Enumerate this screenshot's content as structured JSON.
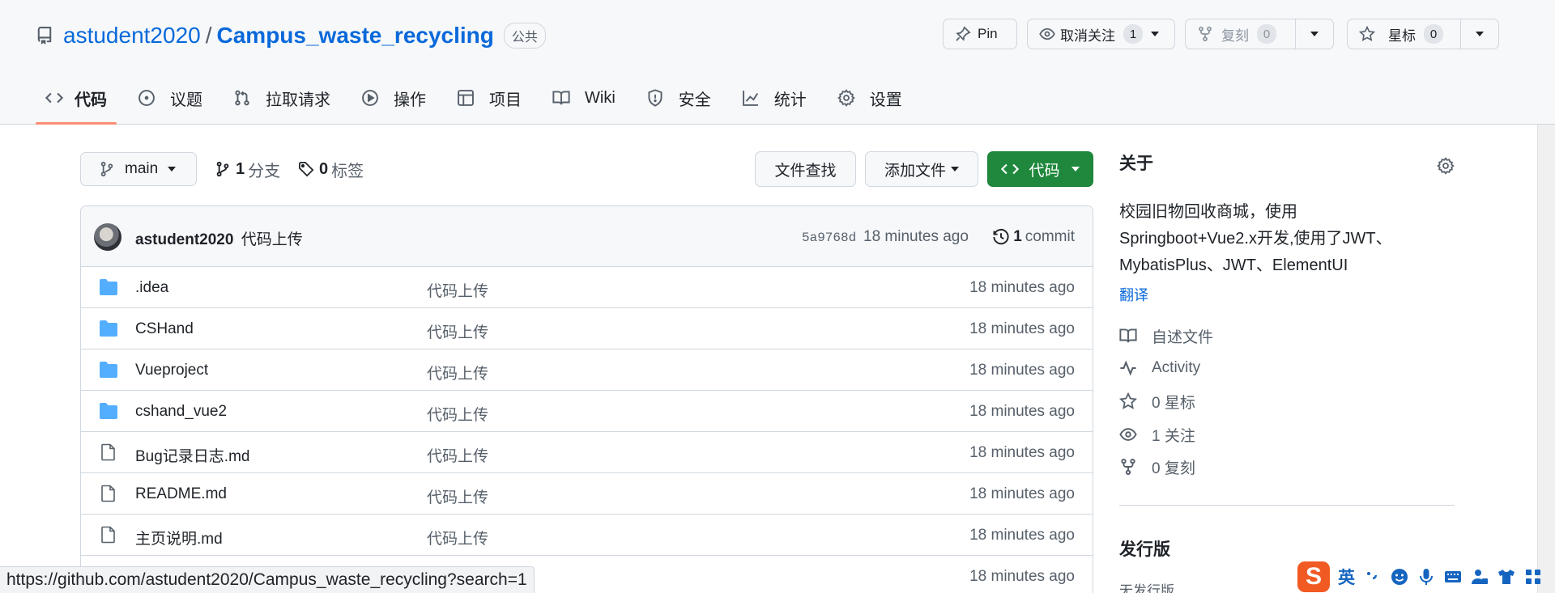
{
  "repo": {
    "owner": "astudent2020",
    "separator": "/",
    "name": "Campus_waste_recycling",
    "visibility": "公共"
  },
  "actions": {
    "pin_label": "Pin",
    "unwatch_label": "取消关注",
    "unwatch_count": "1",
    "fork_label": "复刻",
    "fork_count": "0",
    "star_label": "星标",
    "star_count": "0"
  },
  "tabs": [
    {
      "label": "代码",
      "icon": "code-icon",
      "active": true
    },
    {
      "label": "议题",
      "icon": "issue-icon"
    },
    {
      "label": "拉取请求",
      "icon": "pull-request-icon"
    },
    {
      "label": "操作",
      "icon": "play-icon"
    },
    {
      "label": "项目",
      "icon": "table-icon"
    },
    {
      "label": "Wiki",
      "icon": "book-icon"
    },
    {
      "label": "安全",
      "icon": "shield-icon"
    },
    {
      "label": "统计",
      "icon": "graph-icon"
    },
    {
      "label": "设置",
      "icon": "gear-icon"
    }
  ],
  "branch": {
    "current": "main",
    "branch_count": "1",
    "branch_label": "分支",
    "tag_count": "0",
    "tag_label": "标签"
  },
  "toolbar": {
    "find_file": "文件查找",
    "add_file": "添加文件",
    "code": "代码"
  },
  "commit": {
    "author": "astudent2020",
    "message": "代码上传",
    "sha": "5a9768d",
    "time": "18 minutes ago",
    "count": "1",
    "count_label": "commit"
  },
  "files": [
    {
      "type": "folder",
      "name": ".idea",
      "message": "代码上传",
      "time": "18 minutes ago"
    },
    {
      "type": "folder",
      "name": "CSHand",
      "message": "代码上传",
      "time": "18 minutes ago"
    },
    {
      "type": "folder",
      "name": "Vueproject",
      "message": "代码上传",
      "time": "18 minutes ago"
    },
    {
      "type": "folder",
      "name": "cshand_vue2",
      "message": "代码上传",
      "time": "18 minutes ago"
    },
    {
      "type": "file",
      "name": "Bug记录日志.md",
      "message": "代码上传",
      "time": "18 minutes ago"
    },
    {
      "type": "file",
      "name": "README.md",
      "message": "代码上传",
      "time": "18 minutes ago"
    },
    {
      "type": "file",
      "name": "主页说明.md",
      "message": "代码上传",
      "time": "18 minutes ago"
    },
    {
      "type": "file",
      "name": "",
      "message": "",
      "time": "18 minutes ago"
    }
  ],
  "about": {
    "heading": "关于",
    "description_line1": "校园旧物回收商城，使用",
    "description_line2": "Springboot+Vue2.x开发,使用了JWT、",
    "description_line3": "MybatisPlus、JWT、ElementUI",
    "translate": "翻译",
    "readme": "自述文件",
    "activity": "Activity",
    "stars": "0 星标",
    "watchers": "1 关注",
    "forks": "0 复刻"
  },
  "releases": {
    "heading": "发行版",
    "empty": "无发行版"
  },
  "status_url": "https://github.com/astudent2020/Campus_waste_recycling?search=1",
  "ime": {
    "logo": "S",
    "lang": "英"
  },
  "colors": {
    "link": "#0969da",
    "primary_button": "#1f883d",
    "active_tab_underline": "#fd8c73",
    "folder": "#54aeff"
  }
}
